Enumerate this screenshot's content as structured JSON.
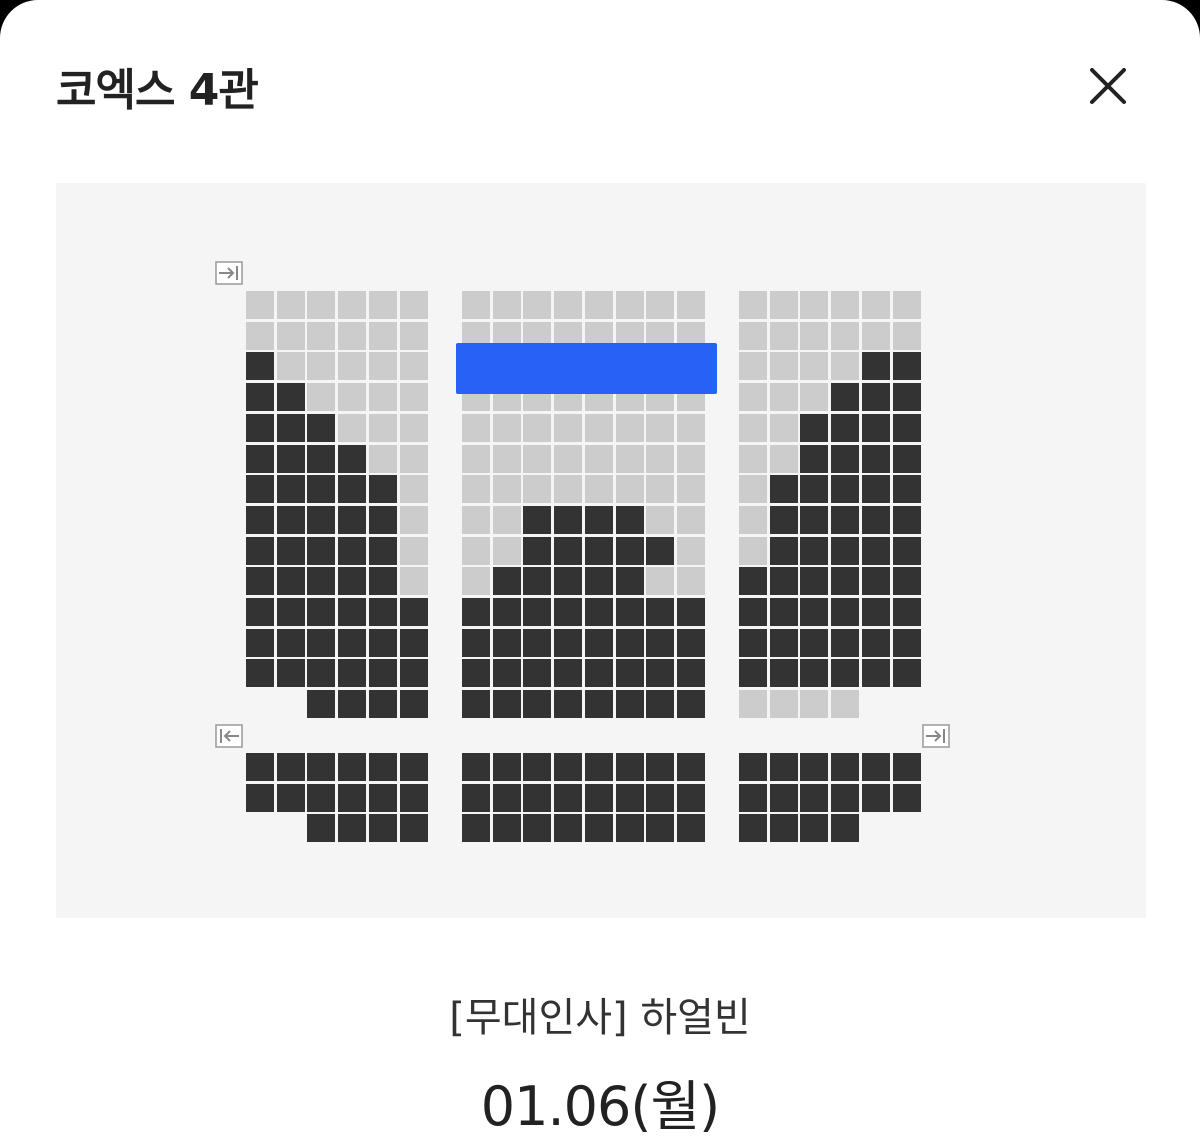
{
  "header": {
    "title": "코엑스 4관",
    "close_icon": "close-icon"
  },
  "colors": {
    "available": "#cccccc",
    "sold": "#333333",
    "selected": "#2761f5",
    "map_background": "#f5f5f5"
  },
  "seat_map": {
    "upper": {
      "left": [
        "AAAAAA",
        "AAAAAA",
        "SAAAAA",
        "SSAAAA",
        "SSSAAA",
        "SSSSAA",
        "SSSSSA",
        "SSSSSA",
        "SSSSSA",
        "SSSSSA",
        "SSSSSS",
        "SSSSSS",
        "SSSSSS",
        "..SSSS"
      ],
      "center": [
        "AAAAAAAA",
        "AAAAAAAA",
        "AAAAAAAA",
        "AAAAAAAA",
        "AAAAAAAA",
        "AAAAAAAA",
        "AAAAAAAA",
        "AASSSSAA",
        "AASSSSSA",
        "ASSSSSAA",
        "SSSSSSSS",
        "SSSSSSSS",
        "SSSSSSSS",
        "SSSSSSSS"
      ],
      "right": [
        "AAAAAA",
        "AAAAAA",
        "AAAASS",
        "AAASSS",
        "AASSSS",
        "AASSSS",
        "ASSSSS",
        "ASSSSS",
        "ASSSSS",
        "SSSSSS",
        "SSSSSS",
        "SSSSSS",
        "SSSSSS",
        "AAAA.."
      ]
    },
    "lower": {
      "left": [
        "SSSSSS",
        "SSSSSS",
        "..SSSS"
      ],
      "center": [
        "SSSSSSSS",
        "SSSSSSSS",
        "SSSSSSSS"
      ],
      "right": [
        "SSSSSS",
        "SSSSSS",
        "SSSS.."
      ]
    },
    "exits": [
      {
        "name": "exit-in-icon-top-left",
        "glyph": "in"
      },
      {
        "name": "exit-out-icon-bottom-left",
        "glyph": "out"
      },
      {
        "name": "exit-in-icon-bottom-right",
        "glyph": "in"
      }
    ]
  },
  "movie": {
    "title": "[무대인사] 하얼빈",
    "date": "01.06(월)"
  }
}
